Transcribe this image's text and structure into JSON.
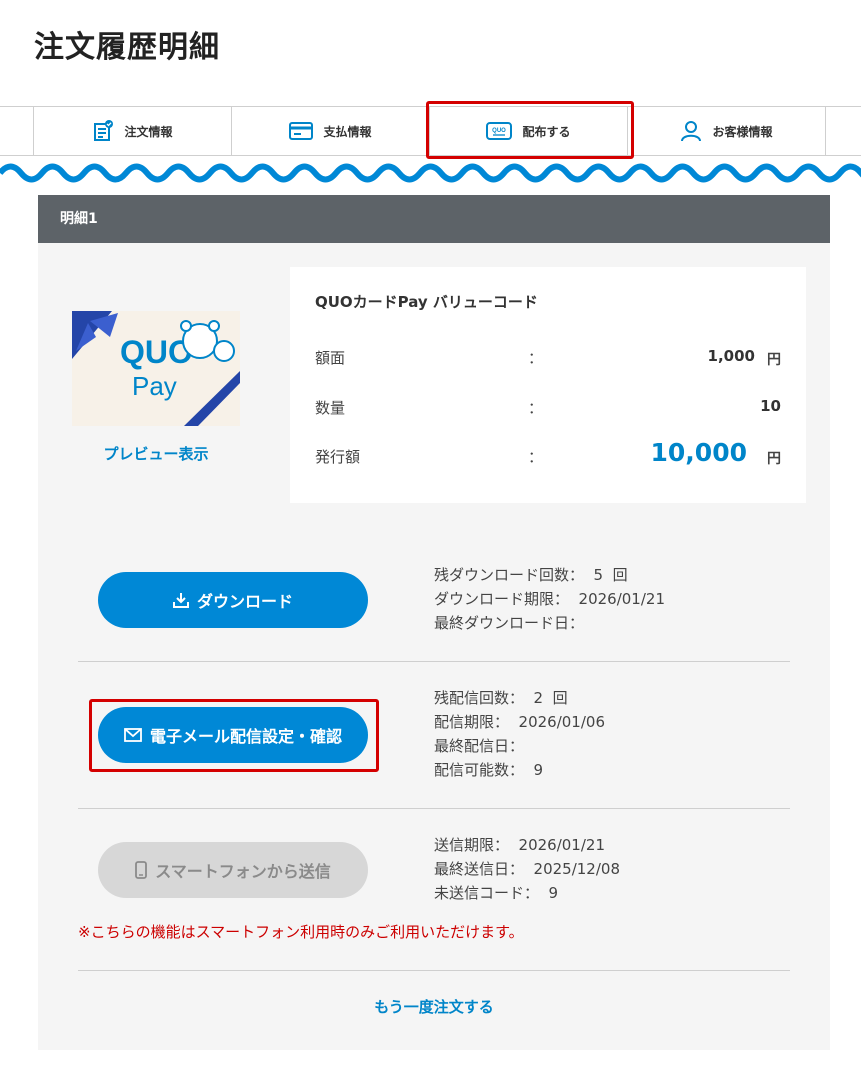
{
  "page_title": "注文履歴明細",
  "tabs": [
    {
      "label": "注文情報",
      "icon": "document-check-icon"
    },
    {
      "label": "支払情報",
      "icon": "credit-card-icon"
    },
    {
      "label": "配布する",
      "icon": "quo-card-icon"
    },
    {
      "label": "お客様情報",
      "icon": "person-icon"
    }
  ],
  "section": {
    "header": "明細1",
    "preview_label": "プレビュー表示",
    "thumbnail": {
      "brand_text": "QUO",
      "sub_text": "Pay"
    },
    "product": {
      "name": "QUOカードPay バリューコード",
      "rows": [
        {
          "label": "額面",
          "colon": "：",
          "value": "1,000",
          "unit": "円"
        },
        {
          "label": "数量",
          "colon": "：",
          "value": "10"
        },
        {
          "label": "発行額",
          "colon": "：",
          "value": "10,000",
          "unit": "円"
        }
      ]
    },
    "download": {
      "button_label": "ダウンロード",
      "info": [
        "残ダウンロード回数：  5  回",
        "ダウンロード期限：  2026/01/21",
        "最終ダウンロード日："
      ]
    },
    "email": {
      "button_label": "電子メール配信設定・確認",
      "info": [
        "残配信回数：  2  回",
        "配信期限：  2026/01/06",
        "最終配信日：",
        "配信可能数：  9"
      ]
    },
    "smartphone": {
      "button_label": "スマートフォンから送信",
      "info": [
        "送信期限：  2026/01/21",
        "最終送信日：  2025/12/08",
        "未送信コード：  9"
      ],
      "notice": "※こちらの機能はスマートフォン利用時のみご利用いただけます。"
    },
    "reorder_label": "もう一度注文する"
  },
  "colors": {
    "accent": "#0088d6",
    "highlight": "#d40000",
    "header_bg": "#5d6368",
    "notice": "#cc0000"
  }
}
